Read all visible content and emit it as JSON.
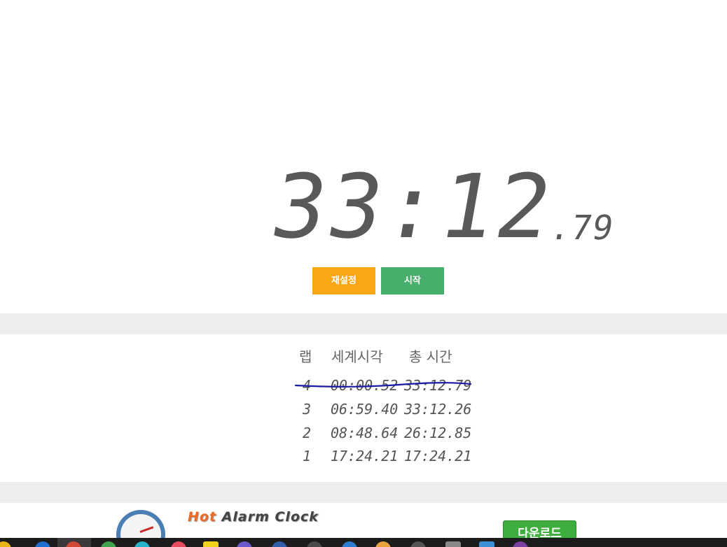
{
  "stopwatch": {
    "time_main": "33:12",
    "time_fraction": ".79",
    "reset_label": "재설정",
    "start_label": "시작"
  },
  "laps": {
    "headers": {
      "lap": "랩",
      "world_time": "세계시각",
      "total_time": "총 시간"
    },
    "rows": [
      {
        "lap": "4",
        "world_time": "00:00.52",
        "total_time": "33:12.79",
        "struck_through": true
      },
      {
        "lap": "3",
        "world_time": "06:59.40",
        "total_time": "33:12.26",
        "struck_through": false
      },
      {
        "lap": "2",
        "world_time": "08:48.64",
        "total_time": "26:12.85",
        "struck_through": false
      },
      {
        "lap": "1",
        "world_time": "17:24.21",
        "total_time": "17:24.21",
        "struck_through": false
      }
    ]
  },
  "ad": {
    "title_hot": "Hot",
    "title_rest": "Alarm Clock",
    "download_label": "다운로드"
  },
  "colors": {
    "reset_button": "#fba614",
    "start_button": "#48ae6b",
    "digits": "#595959",
    "strike_line": "#1a1aa8"
  },
  "taskbar": {
    "icons": [
      "windows-icon",
      "edge-icon",
      "chrome-icon",
      "browser-icon",
      "app-icon",
      "app-icon",
      "folder-icon",
      "app-icon",
      "app-icon",
      "app-icon",
      "app-icon",
      "app-icon",
      "app-icon",
      "app-icon",
      "app-icon"
    ]
  }
}
